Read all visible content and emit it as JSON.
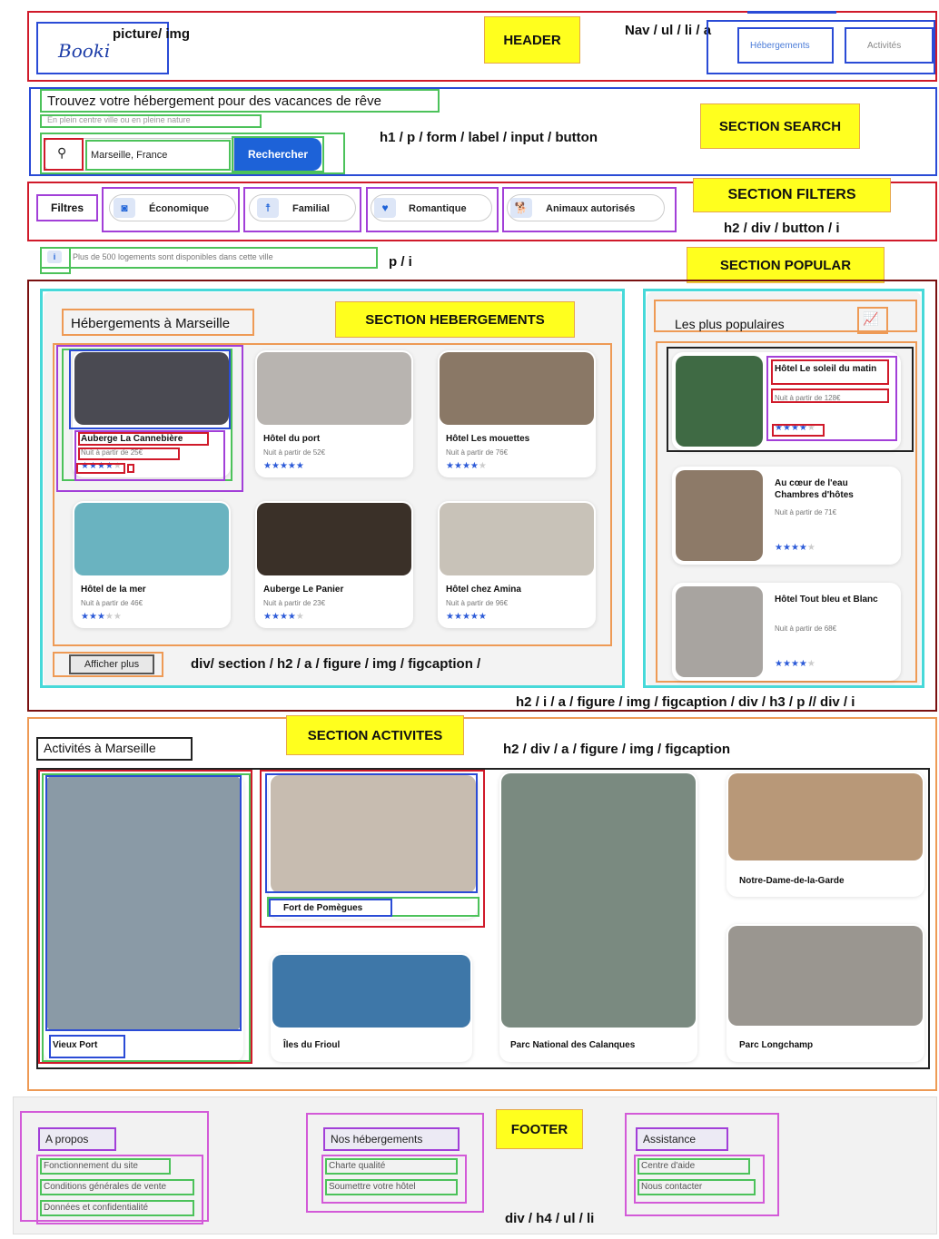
{
  "header": {
    "logo": "Booki",
    "label": "HEADER",
    "ann_picture": "picture/  img",
    "ann_nav": "Nav / ul / li / a",
    "nav": [
      "Hébergements",
      "Activités"
    ]
  },
  "search": {
    "title": "Trouvez votre hébergement pour des vacances de rêve",
    "subtitle": "En plein centre ville ou en pleine nature",
    "location": "Marseille, France",
    "button": "Rechercher",
    "label": "SECTION SEARCH",
    "ann": "h1 / p / form / label / input / button"
  },
  "filters": {
    "title": "Filtres",
    "items": [
      "Économique",
      "Familial",
      "Romantique",
      "Animaux autorisés"
    ],
    "label": "SECTION FILTERS",
    "ann": "h2 / div / button / i"
  },
  "info": {
    "text": "Plus de 500 logements sont disponibles dans cette ville",
    "ann": "p /  i"
  },
  "popular_label": "SECTION POPULAR",
  "hebergements": {
    "title": "Hébergements à Marseille",
    "label": "SECTION HEBERGEMENTS",
    "cards": [
      {
        "name": "Auberge La Cannebière",
        "price": "Nuit à partir de 25€",
        "rating": 4,
        "color": "#4a4a52"
      },
      {
        "name": "Hôtel du port",
        "price": "Nuit à partir de 52€",
        "rating": 5,
        "color": "#b8b4b0"
      },
      {
        "name": "Hôtel Les mouettes",
        "price": "Nuit à partir de 76€",
        "rating": 4,
        "color": "#8a7866"
      },
      {
        "name": "Hôtel de la mer",
        "price": "Nuit à partir de 46€",
        "rating": 3,
        "color": "#6ab3c0"
      },
      {
        "name": "Auberge Le Panier",
        "price": "Nuit à partir de 23€",
        "rating": 4,
        "color": "#3a3028"
      },
      {
        "name": "Hôtel chez Amina",
        "price": "Nuit à partir de 96€",
        "rating": 5,
        "color": "#c8c2b8"
      }
    ],
    "more": "Afficher plus",
    "ann": "div/ section / h2 / a / figure / img / figcaption /"
  },
  "populaires": {
    "title": "Les plus populaires",
    "cards": [
      {
        "name": "Hôtel Le soleil du matin",
        "price": "Nuit à partir de 128€",
        "rating": 4,
        "color": "#3f6a44"
      },
      {
        "name": "Au cœur de l'eau Chambres d'hôtes",
        "price": "Nuit à partir de 71€",
        "rating": 4,
        "color": "#8d7a68"
      },
      {
        "name": "Hôtel Tout bleu et Blanc",
        "price": "Nuit à partir de 68€",
        "rating": 4,
        "color": "#a8a4a0"
      }
    ],
    "ann": "h2 / i / a / figure / img / figcaption / div / h3 / p // div / i"
  },
  "activites": {
    "title": "Activités à Marseille",
    "label": "SECTION ACTIVITES",
    "ann": "h2 / div / a / figure / img / figcaption",
    "items": [
      {
        "name": "Vieux Port",
        "color": "#8a9aa6"
      },
      {
        "name": "Fort de Pomègues",
        "color": "#c7bcb0"
      },
      {
        "name": "Îles du Frioul",
        "color": "#3e77a8"
      },
      {
        "name": "Parc National des Calanques",
        "color": "#7a8a80"
      },
      {
        "name": "Notre-Dame-de-la-Garde",
        "color": "#b89878"
      },
      {
        "name": "Parc Longchamp",
        "color": "#9a9690"
      }
    ]
  },
  "footer": {
    "label": "FOOTER",
    "ann": "div / h4 / ul / li",
    "cols": [
      {
        "title": "A propos",
        "links": [
          "Fonctionnement du site",
          "Conditions générales de vente",
          "Données et confidentialité"
        ]
      },
      {
        "title": "Nos hébergements",
        "links": [
          "Charte qualité",
          "Soumettre votre hôtel"
        ]
      },
      {
        "title": "Assistance",
        "links": [
          "Centre d'aide",
          "Nous contacter"
        ]
      }
    ]
  },
  "colors": {
    "accent": "#1d62d8",
    "star": "#2d5bd8",
    "label_bg": "#ffff1e",
    "footer_bg": "#f2f2f2"
  }
}
